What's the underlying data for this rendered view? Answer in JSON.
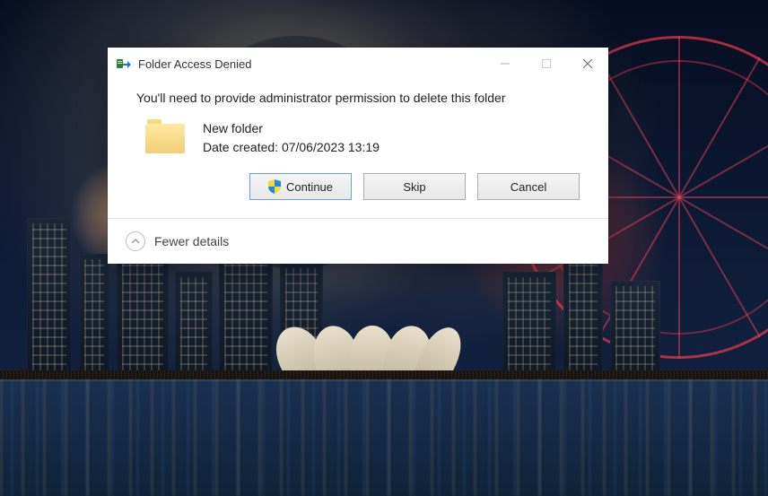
{
  "dialog": {
    "title": "Folder Access Denied",
    "message": "You'll need to provide administrator permission to delete this folder",
    "item": {
      "name": "New folder",
      "date_line": "Date created: 07/06/2023 13:19"
    },
    "buttons": {
      "continue": "Continue",
      "skip": "Skip",
      "cancel": "Cancel"
    },
    "footer": {
      "toggle_label": "Fewer details"
    }
  }
}
